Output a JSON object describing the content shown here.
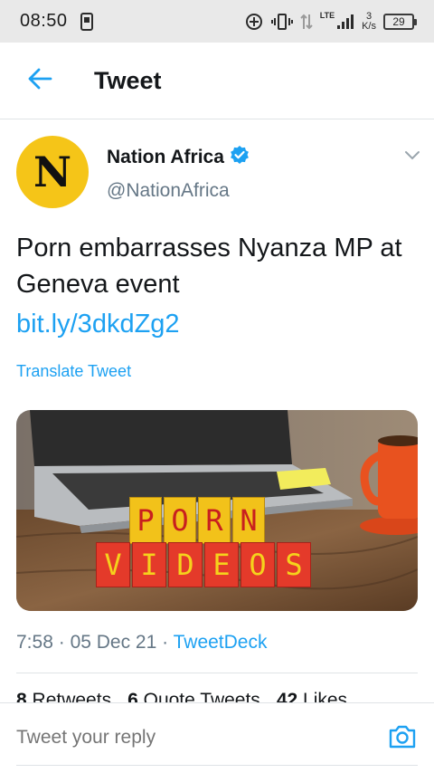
{
  "status_bar": {
    "time": "08:50",
    "network": "LTE",
    "speed_value": "3",
    "speed_unit": "K/s",
    "battery": "29"
  },
  "header": {
    "title": "Tweet",
    "back_icon": "arrow-left-icon"
  },
  "tweet": {
    "author_name": "Nation Africa",
    "author_handle": "@NationAfrica",
    "avatar_letter": "N",
    "verified": true,
    "text": "Porn embarrasses Nyanza MP at Geneva event",
    "link": "bit.ly/3dkdZg2",
    "translate_label": "Translate Tweet",
    "media": {
      "row1": [
        "P",
        "O",
        "R",
        "N"
      ],
      "row2": [
        "V",
        "I",
        "D",
        "E",
        "O",
        "S"
      ]
    },
    "time": "7:58",
    "separator": "·",
    "date": "05 Dec 21",
    "source": "TweetDeck",
    "stats": {
      "retweets_count": "8",
      "retweets_label": "Retweets",
      "quotes_count": "6",
      "quotes_label": "Quote Tweets",
      "likes_count": "42",
      "likes_label": "Likes"
    }
  },
  "reply": {
    "placeholder": "Tweet your reply",
    "camera_icon": "camera-icon"
  },
  "colors": {
    "accent": "#1da1f2",
    "text_secondary": "#657786",
    "avatar_bg": "#f5c518"
  }
}
